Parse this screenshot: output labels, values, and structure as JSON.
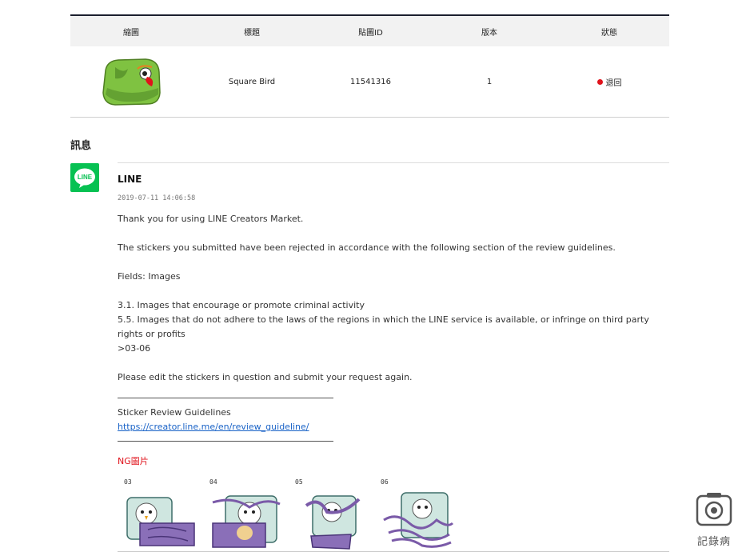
{
  "table": {
    "headers": [
      "縮圖",
      "標題",
      "貼圖ID",
      "版本",
      "狀態"
    ],
    "row": {
      "title": "Square Bird",
      "sticker_id": "11541316",
      "version": "1",
      "status": "退回",
      "status_color": "#e0121b"
    }
  },
  "messages_section": {
    "title": "訊息"
  },
  "message": {
    "logo_text": "LINE",
    "sender": "LINE",
    "timestamp": "2019-07-11 14:06:58",
    "p1": "Thank you for using LINE Creators Market.",
    "p2": "The stickers you submitted have been rejected in accordance with the following section of the review guidelines.",
    "fields": "Fields: Images",
    "rule1": "3.1. Images that encourage or promote criminal activity",
    "rule2": "5.5. Images that do not adhere to the laws of the regions in which the LINE service is available, or infringe on third party rights or profits",
    "ids": ">03-06",
    "p4": "Please edit the stickers in question and submit your request again.",
    "guidelines_label": "Sticker Review Guidelines",
    "guidelines_url": "https://creator.line.me/en/review_guideline/",
    "ng_title": "NG圖片",
    "ng_items": [
      "03",
      "04",
      "05",
      "06"
    ]
  },
  "watermark": {
    "text": "記錄病"
  },
  "colors": {
    "line_green": "#06c152",
    "header_bg": "#f2f2f2",
    "link": "#1a63c7",
    "alert_red": "#e0121b"
  }
}
